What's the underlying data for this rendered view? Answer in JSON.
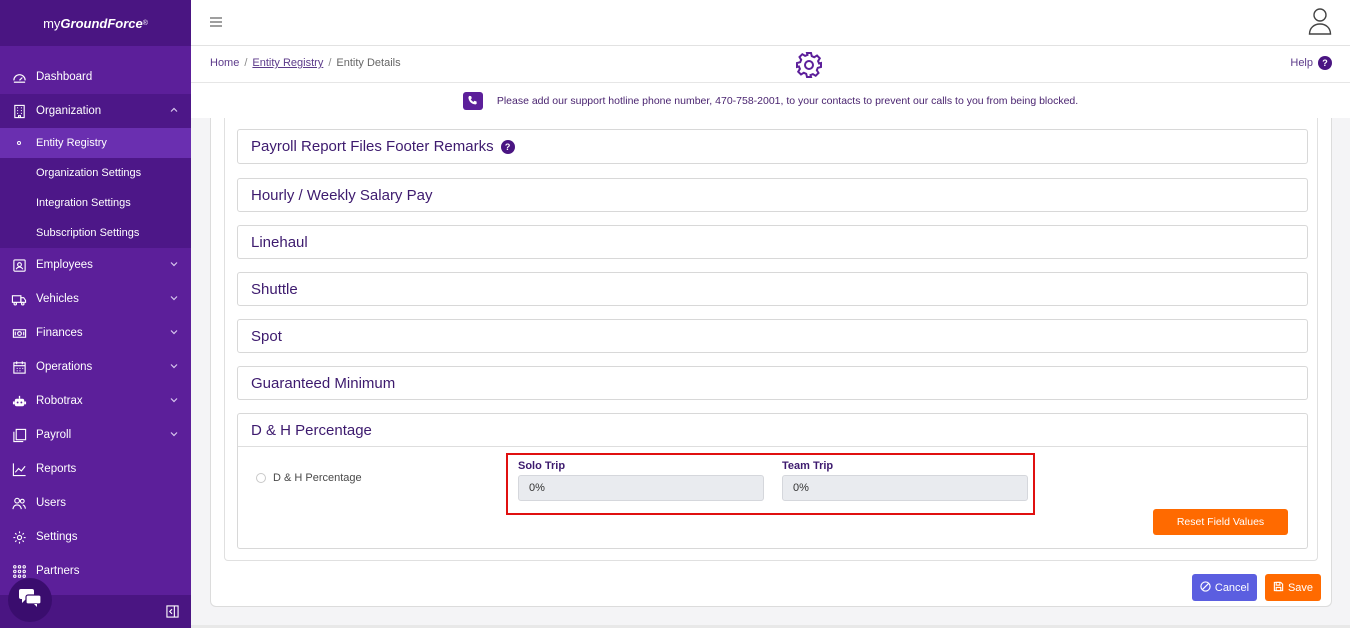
{
  "app": {
    "logo_prefix": "my",
    "logo_brand": "GroundForce",
    "logo_mark": "®"
  },
  "sidebar": {
    "items": [
      {
        "label": "Dashboard",
        "icon": "dashboard-icon"
      },
      {
        "label": "Organization",
        "icon": "building-icon",
        "expanded": true
      },
      {
        "label": "Employees",
        "icon": "id-card-icon"
      },
      {
        "label": "Vehicles",
        "icon": "truck-icon"
      },
      {
        "label": "Finances",
        "icon": "money-icon"
      },
      {
        "label": "Operations",
        "icon": "calendar-icon"
      },
      {
        "label": "Robotrax",
        "icon": "robot-icon"
      },
      {
        "label": "Payroll",
        "icon": "copy-icon"
      },
      {
        "label": "Reports",
        "icon": "chart-line-icon"
      },
      {
        "label": "Users",
        "icon": "users-icon"
      },
      {
        "label": "Settings",
        "icon": "gear-icon"
      },
      {
        "label": "Partners",
        "icon": "grid-icon"
      }
    ],
    "org_subitems": [
      {
        "label": "Entity Registry",
        "active": true
      },
      {
        "label": "Organization Settings"
      },
      {
        "label": "Integration Settings"
      },
      {
        "label": "Subscription Settings"
      }
    ]
  },
  "breadcrumb": {
    "home": "Home",
    "registry": "Entity Registry",
    "current": "Entity Details",
    "separator": "/"
  },
  "help": {
    "label": "Help",
    "badge": "?"
  },
  "notice": {
    "text": "Please add our support hotline phone number, 470-758-2001, to your contacts to prevent our calls to you from being blocked."
  },
  "sections": [
    {
      "title": "Payroll Report Files Footer Remarks",
      "has_help": true,
      "help_badge": "?"
    },
    {
      "title": "Hourly / Weekly Salary Pay"
    },
    {
      "title": "Linehaul"
    },
    {
      "title": "Shuttle"
    },
    {
      "title": "Spot"
    },
    {
      "title": "Guaranteed Minimum"
    },
    {
      "title": "D & H Percentage"
    }
  ],
  "dh": {
    "radio_label": "D & H Percentage",
    "solo_label": "Solo Trip",
    "solo_value": "0%",
    "team_label": "Team Trip",
    "team_value": "0%",
    "reset_label": "Reset Field Values"
  },
  "actions": {
    "cancel_label": "Cancel",
    "save_label": "Save"
  },
  "colors": {
    "sidebar": "#5c1f9a",
    "accent_orange": "#ff6a00",
    "cancel_blue": "#5b5ee0",
    "highlight_red": "#e01010"
  }
}
